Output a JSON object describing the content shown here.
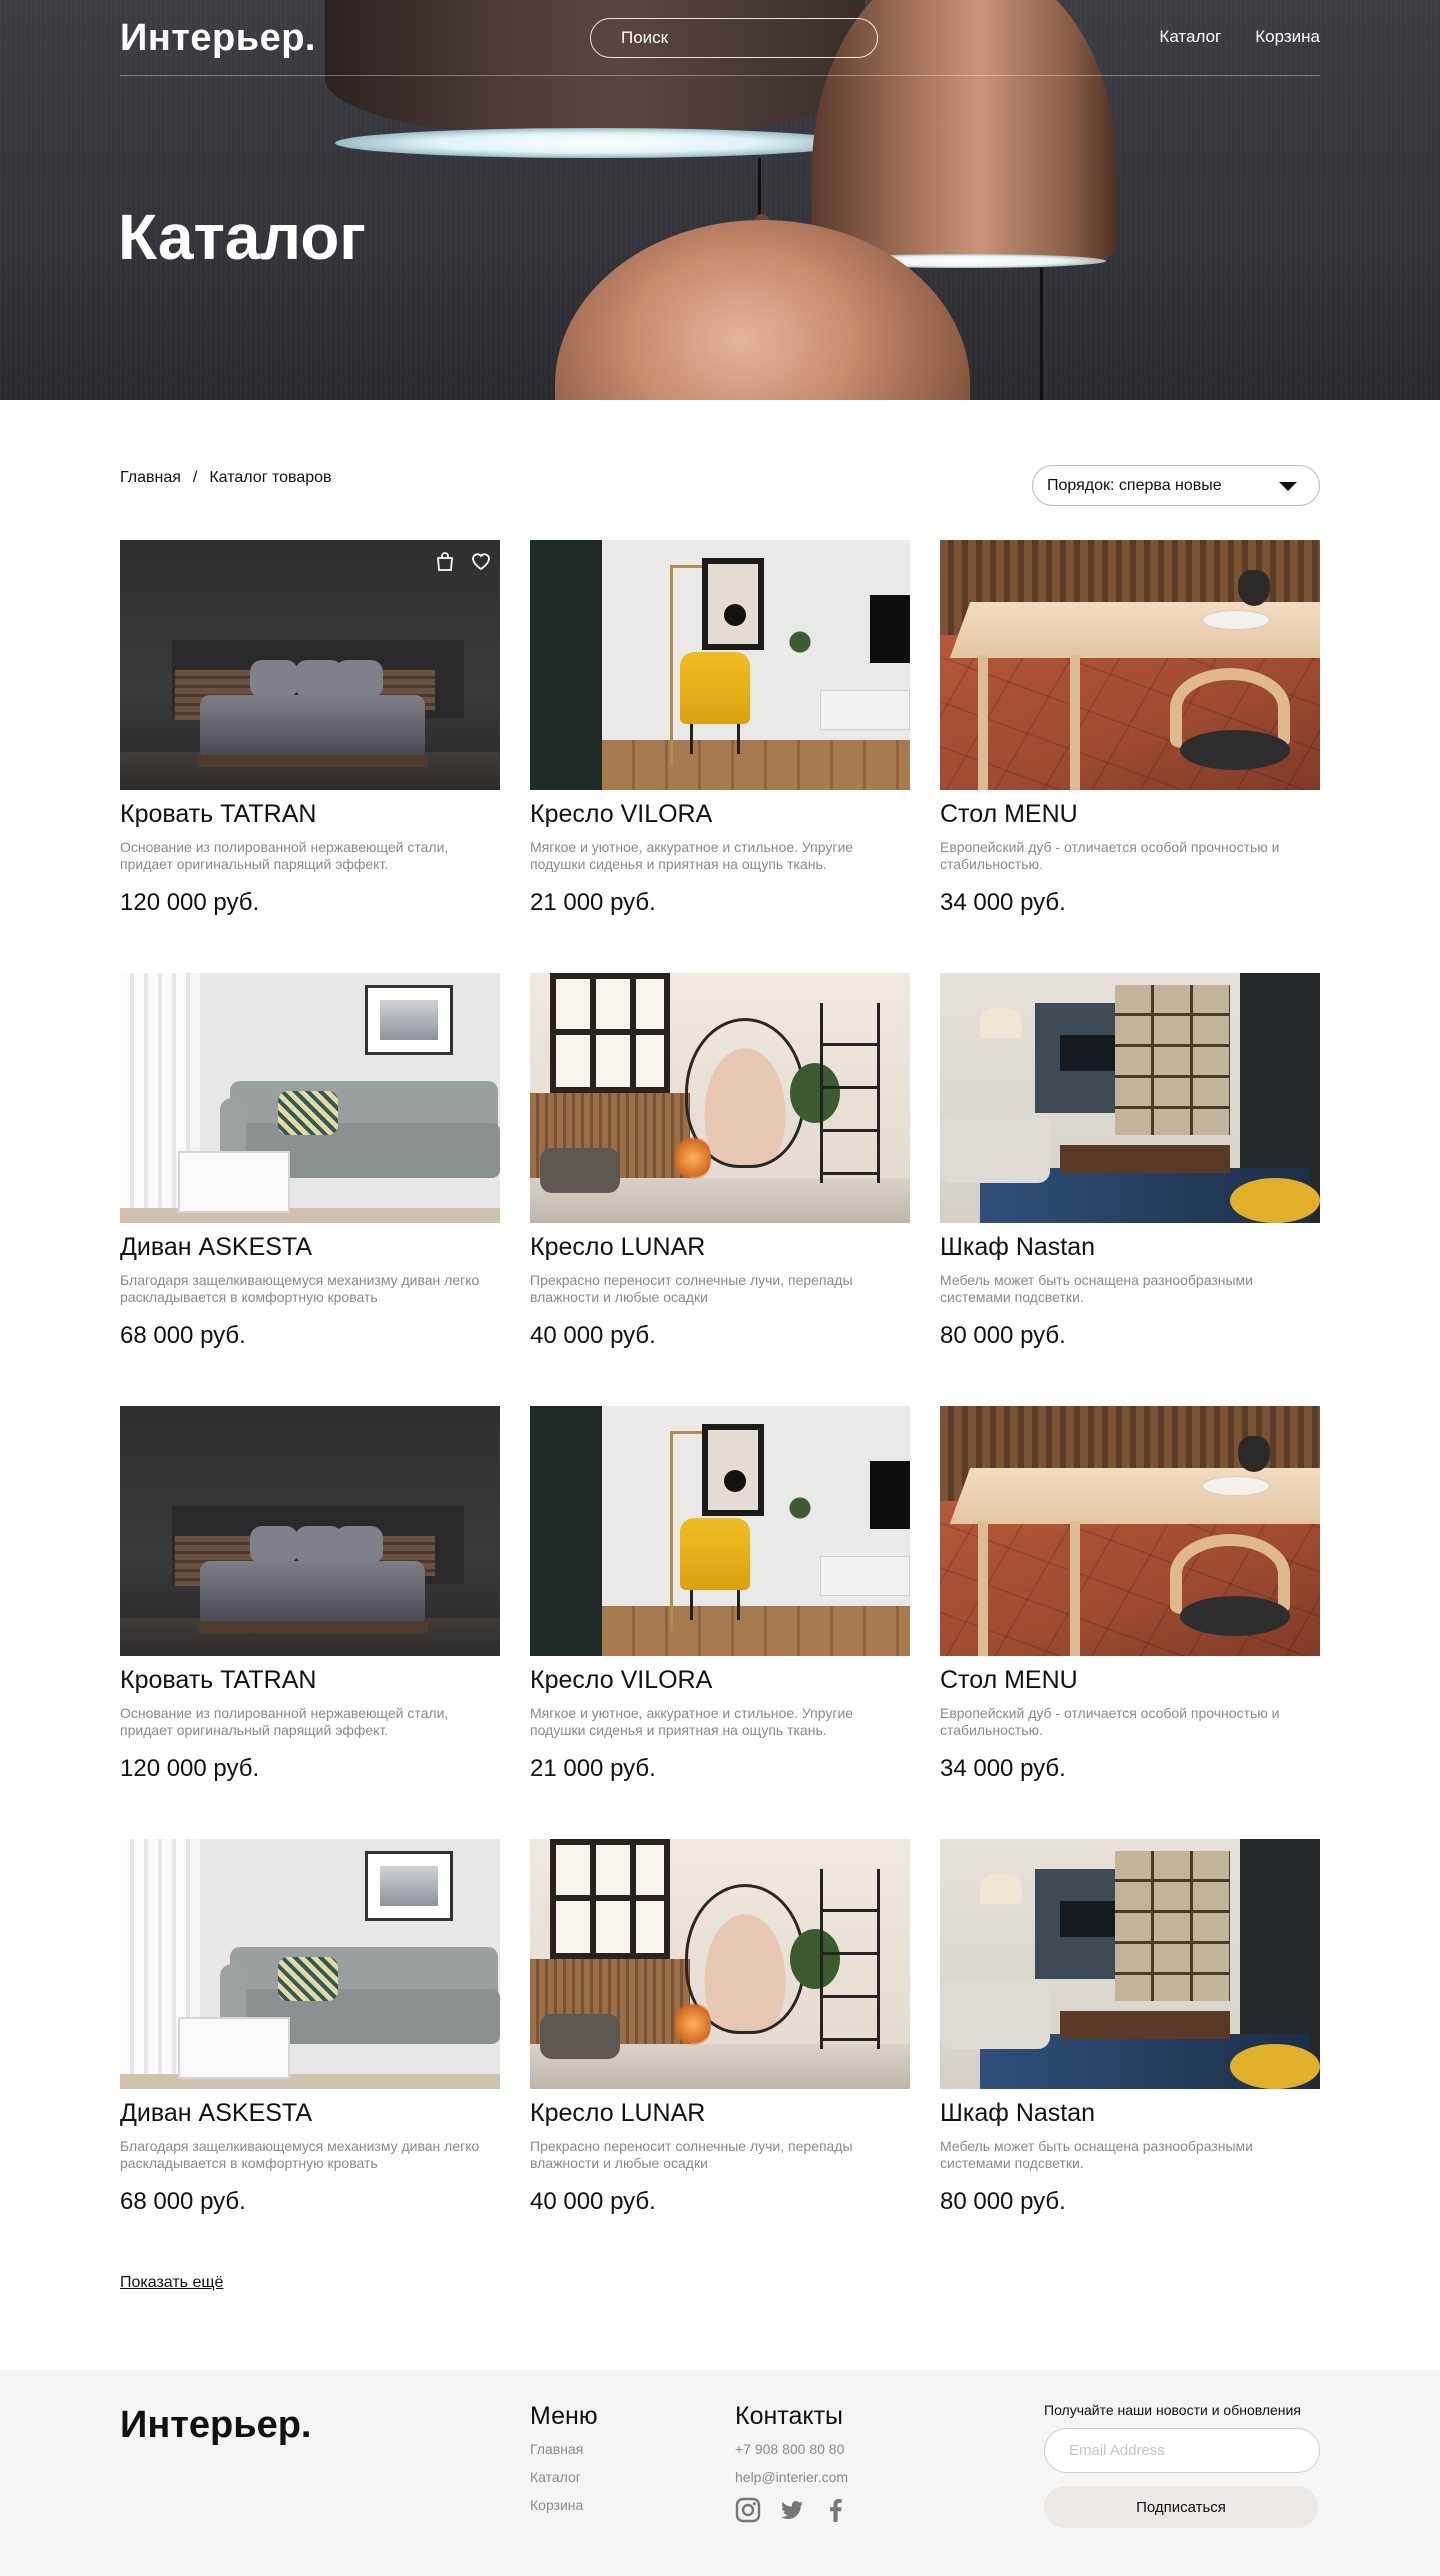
{
  "header": {
    "logo": "Интерьер.",
    "search_placeholder": "Поиск",
    "nav": [
      "Каталог",
      "Корзина"
    ],
    "hero_title": "Каталог"
  },
  "breadcrumb": [
    "Главная",
    "/",
    "Каталог товаров"
  ],
  "sort": {
    "label": "Порядок: сперва новые",
    "icon": "chevron-down-icon"
  },
  "card_icons": [
    "bag-icon",
    "heart-icon"
  ],
  "products": [
    {
      "title": "Кровать TATRAN",
      "desc": "Основание из полированной нержавеющей стали, придает оригинальный парящий эффект.",
      "price": "120 000 руб.",
      "scene": "bed"
    },
    {
      "title": "Кресло VILORA",
      "desc": "Мягкое и уютное, аккуратное и стильное. Упругие подушки сиденья и приятная на ощупь ткань.",
      "price": "21 000 руб.",
      "scene": "chair"
    },
    {
      "title": "Стол MENU",
      "desc": "Европейский дуб - отличается особой прочностью и стабильностью.",
      "price": "34 000 руб.",
      "scene": "table"
    },
    {
      "title": "Диван ASKESTA",
      "desc": "Благодаря защелкивающемуся механизму диван легко раскладывается в комфортную кровать",
      "price": "68 000 руб.",
      "scene": "sofa"
    },
    {
      "title": "Кресло LUNAR",
      "desc": "Прекрасно переносит солнечные лучи, перепады влажности и любые осадки",
      "price": "40 000 руб.",
      "scene": "hang"
    },
    {
      "title": "Шкаф Nastan",
      "desc": "Мебель может быть оснащена разнообразными системами подсветки.",
      "price": "80 000 руб.",
      "scene": "shelf"
    },
    {
      "title": "Кровать TATRAN",
      "desc": "Основание из полированной нержавеющей стали, придает оригинальный парящий эффект.",
      "price": "120 000 руб.",
      "scene": "bed"
    },
    {
      "title": "Кресло VILORA",
      "desc": "Мягкое и уютное, аккуратное и стильное. Упругие подушки сиденья и приятная на ощупь ткань.",
      "price": "21 000 руб.",
      "scene": "chair"
    },
    {
      "title": "Стол MENU",
      "desc": "Европейский дуб - отличается особой прочностью и стабильностью.",
      "price": "34 000 руб.",
      "scene": "table"
    },
    {
      "title": "Диван ASKESTA",
      "desc": "Благодаря защелкивающемуся механизму диван легко раскладывается в комфортную кровать",
      "price": "68 000 руб.",
      "scene": "sofa"
    },
    {
      "title": "Кресло LUNAR",
      "desc": "Прекрасно переносит солнечные лучи, перепады влажности и любые осадки",
      "price": "40 000 руб.",
      "scene": "hang"
    },
    {
      "title": "Шкаф Nastan",
      "desc": "Мебель может быть оснащена разнообразными системами подсветки.",
      "price": "80 000 руб.",
      "scene": "shelf"
    }
  ],
  "show_more": "Показать ещё",
  "footer": {
    "logo": "Интерьер.",
    "menu_title": "Меню",
    "menu": [
      "Главная",
      "Каталог",
      "Корзина"
    ],
    "contacts_title": "Контакты",
    "phone": "+7 908 800 80 80",
    "email": "help@interier.com",
    "socials": [
      "instagram-icon",
      "twitter-icon",
      "facebook-icon"
    ],
    "subscribe_caption": "Получайте наши новости и обновления",
    "email_placeholder": "Email Address",
    "subscribe_button": "Подписаться"
  }
}
